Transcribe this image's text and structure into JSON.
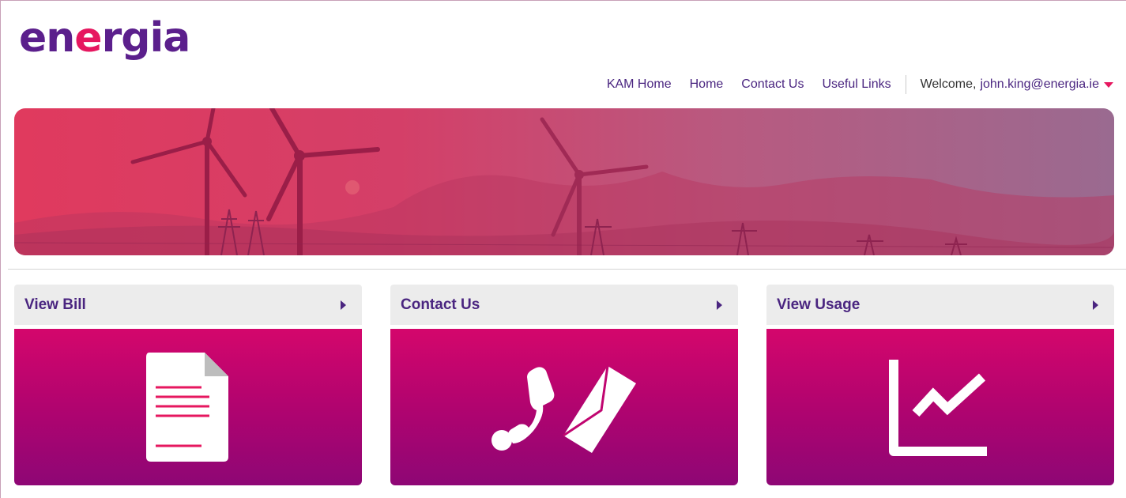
{
  "brand": {
    "logo_pre": "en",
    "logo_accent": "e",
    "logo_post": "rgia",
    "primary_color": "#5b1f8c",
    "accent_color": "#e6175f"
  },
  "nav": {
    "links": [
      "KAM Home",
      "Home",
      "Contact Us",
      "Useful Links"
    ],
    "welcome": "Welcome,",
    "email": "john.king@energia.ie"
  },
  "cards": [
    {
      "title": "View Bill",
      "icon": "document-icon"
    },
    {
      "title": "Contact Us",
      "icon": "phone-envelope-icon"
    },
    {
      "title": "View Usage",
      "icon": "line-chart-icon"
    }
  ]
}
